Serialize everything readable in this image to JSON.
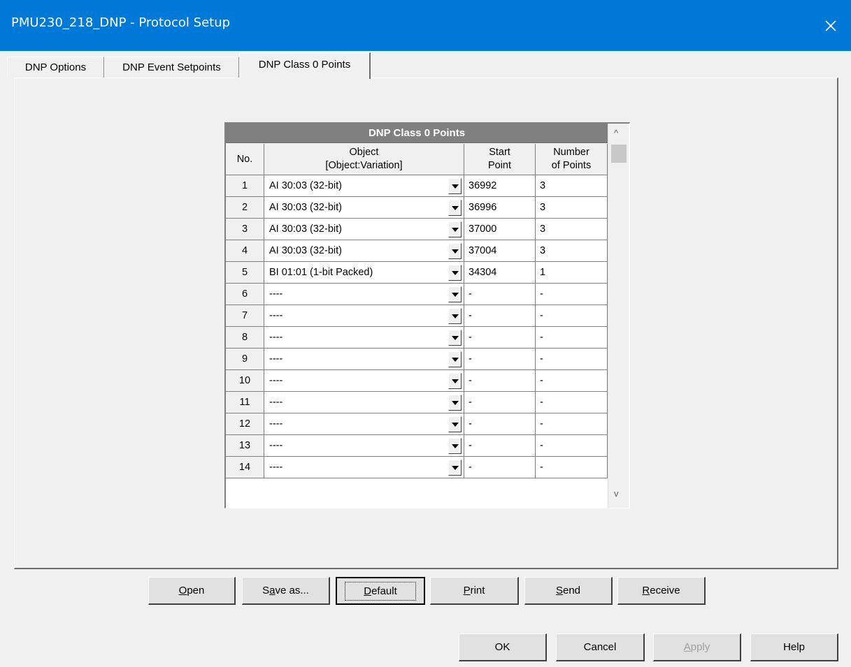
{
  "window": {
    "title": "PMU230_218_DNP - Protocol Setup",
    "close_glyph": "✕"
  },
  "tabs": [
    {
      "label": "DNP Options",
      "active": false
    },
    {
      "label": "DNP Event Setpoints",
      "active": false
    },
    {
      "label": "DNP Class 0 Points",
      "active": true
    }
  ],
  "grid": {
    "caption": "DNP Class 0 Points",
    "headers": {
      "no": "No.",
      "object_line1": "Object",
      "object_line2": "[Object:Variation]",
      "start_line1": "Start",
      "start_line2": "Point",
      "count_line1": "Number",
      "count_line2": "of Points"
    },
    "rows": [
      {
        "no": "1",
        "object": "AI 30:03 (32-bit)",
        "start": "36992",
        "count": "3"
      },
      {
        "no": "2",
        "object": "AI 30:03 (32-bit)",
        "start": "36996",
        "count": "3"
      },
      {
        "no": "3",
        "object": "AI 30:03 (32-bit)",
        "start": "37000",
        "count": "3"
      },
      {
        "no": "4",
        "object": "AI 30:03 (32-bit)",
        "start": "37004",
        "count": "3"
      },
      {
        "no": "5",
        "object": "BI 01:01 (1-bit Packed)",
        "start": "34304",
        "count": "1"
      },
      {
        "no": "6",
        "object": "----",
        "start": "-",
        "count": "-"
      },
      {
        "no": "7",
        "object": "----",
        "start": "-",
        "count": "-"
      },
      {
        "no": "8",
        "object": "----",
        "start": "-",
        "count": "-"
      },
      {
        "no": "9",
        "object": "----",
        "start": "-",
        "count": "-"
      },
      {
        "no": "10",
        "object": "----",
        "start": "-",
        "count": "-"
      },
      {
        "no": "11",
        "object": "----",
        "start": "-",
        "count": "-"
      },
      {
        "no": "12",
        "object": "----",
        "start": "-",
        "count": "-"
      },
      {
        "no": "13",
        "object": "----",
        "start": "-",
        "count": "-"
      },
      {
        "no": "14",
        "object": "----",
        "start": "-",
        "count": "-"
      }
    ],
    "scroll_up_glyph": "^",
    "scroll_down_glyph": "v"
  },
  "actions": {
    "open": {
      "access": "O",
      "rest": "pen"
    },
    "save_as": {
      "pre": "S",
      "access": "a",
      "rest": "ve as..."
    },
    "default": {
      "access": "D",
      "rest": "efault"
    },
    "print": {
      "access": "P",
      "rest": "rint"
    },
    "send": {
      "access": "S",
      "rest": "end"
    },
    "receive": {
      "access": "R",
      "rest": "eceive"
    }
  },
  "dialog_buttons": {
    "ok": "OK",
    "cancel": "Cancel",
    "apply": {
      "access": "A",
      "rest": "pply"
    },
    "help": "Help"
  }
}
